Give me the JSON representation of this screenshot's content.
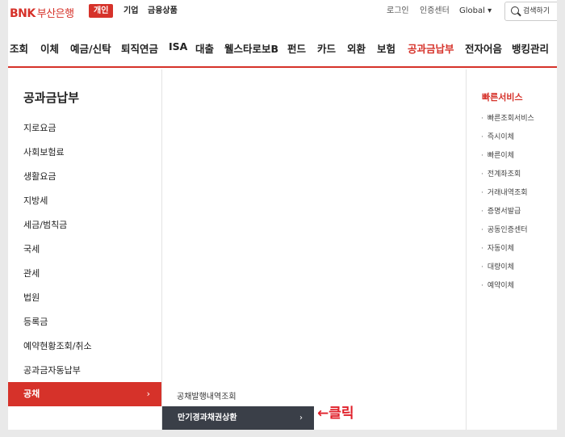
{
  "header": {
    "logo_text": "BNK",
    "bank_name": "부산은행",
    "segments": [
      "개인",
      "기업",
      "금융상품"
    ],
    "utils": {
      "login": "로그인",
      "cert": "인증센터",
      "global": "Global ▾"
    },
    "search_label": "검색하기"
  },
  "gnb": {
    "items": [
      "조회",
      "이체",
      "예금/신탁",
      "퇴직연금",
      "ISA",
      "대출",
      "웰스타로보B",
      "펀드",
      "카드",
      "외환",
      "보험",
      "공과금납부",
      "전자어음",
      "뱅킹관리"
    ],
    "active": "공과금납부"
  },
  "left_menu": {
    "title": "공과금납부",
    "items": [
      "지로요금",
      "사회보험료",
      "생활요금",
      "지방세",
      "세금/범칙금",
      "국세",
      "관세",
      "법원",
      "등록금",
      "예약현황조회/취소",
      "공과금자동납부",
      "공채"
    ],
    "active_chevron": "›"
  },
  "sub_menu": {
    "items": [
      "공채발행내역조회",
      "만기경과채권상환"
    ],
    "active_chevron": "›"
  },
  "quick": {
    "title": "빠른서비스",
    "items": [
      "빠른조회서비스",
      "즉시이체",
      "빠른이체",
      "전계좌조회",
      "거래내역조회",
      "증명서발급",
      "공동인증센터",
      "자동이체",
      "대량이체",
      "예약이체"
    ]
  },
  "annotation": "←클릭",
  "colors": {
    "brand_red": "#d6322a",
    "dark": "#3a3f48"
  }
}
